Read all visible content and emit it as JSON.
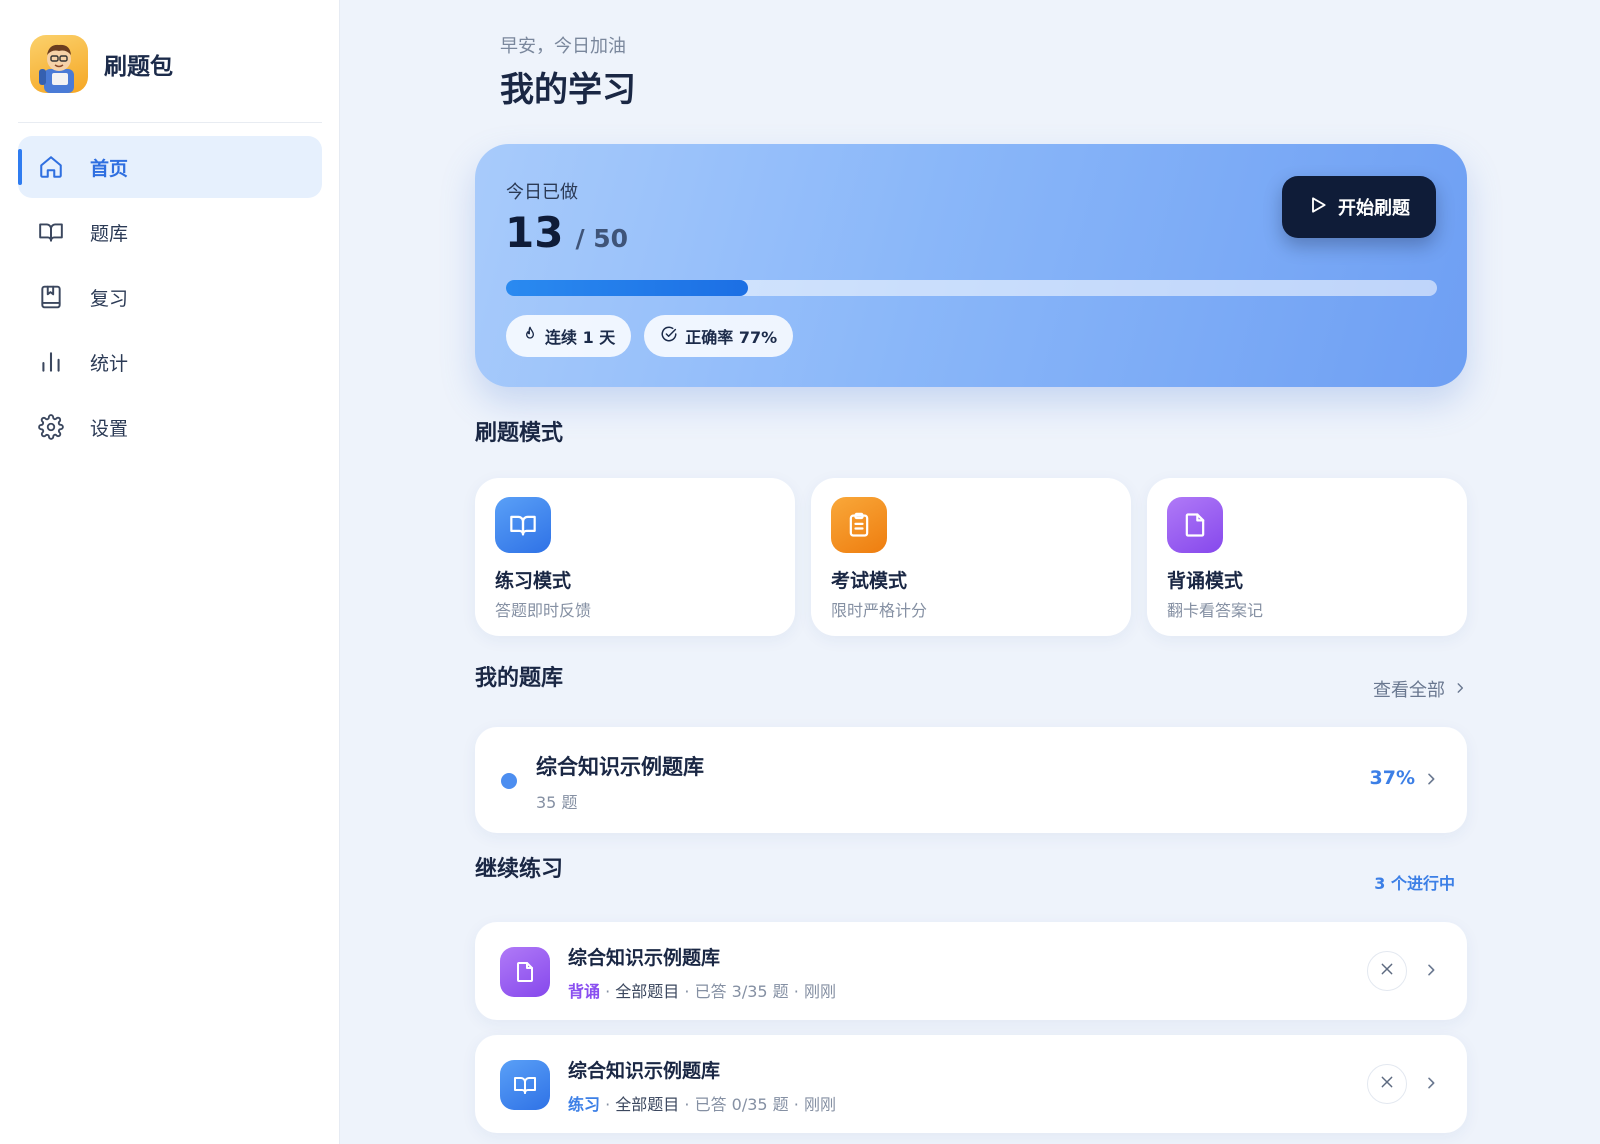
{
  "app": {
    "name": "刷题包"
  },
  "sidebar": {
    "items": [
      {
        "label": "首页",
        "icon": "home-icon",
        "active": true
      },
      {
        "label": "题库",
        "icon": "book-open-icon"
      },
      {
        "label": "复习",
        "icon": "bookmark-book-icon"
      },
      {
        "label": "统计",
        "icon": "bar-chart-icon"
      },
      {
        "label": "设置",
        "icon": "gear-icon"
      }
    ]
  },
  "header": {
    "greeting": "早安，今日加油",
    "title": "我的学习"
  },
  "today": {
    "label": "今日已做",
    "done": "13",
    "total": "/ 50",
    "progress": 0.26,
    "streak": "连续 1 天",
    "accuracy": "正确率 77%",
    "start_label": "开始刷题"
  },
  "modes": {
    "title": "刷题模式",
    "items": [
      {
        "name": "练习模式",
        "desc": "答题即时反馈",
        "icon": "book-open-icon",
        "color": "#3f86f1"
      },
      {
        "name": "考试模式",
        "desc": "限时严格计分",
        "icon": "clipboard-icon",
        "color": "#f28c1b"
      },
      {
        "name": "背诵模式",
        "desc": "翻卡看答案记",
        "icon": "file-icon",
        "color": "#9b5cf0"
      }
    ]
  },
  "my_banks": {
    "title": "我的题库",
    "view_all": "查看全部",
    "items": [
      {
        "name": "综合知识示例题库",
        "count": "35 题",
        "percent": "37%"
      }
    ]
  },
  "continue": {
    "title": "继续练习",
    "badge": "3 个进行中",
    "items": [
      {
        "name": "综合知识示例题库",
        "mode": "背诵",
        "mode_color": "#8a4ff0",
        "scope": "全部题目",
        "answered": "已答 3/35 题",
        "time": "刚刚",
        "icon": "file-icon"
      },
      {
        "name": "综合知识示例题库",
        "mode": "练习",
        "mode_color": "#3c7fe6",
        "scope": "全部题目",
        "answered": "已答 0/35 题",
        "time": "刚刚",
        "icon": "book-open-icon"
      }
    ],
    "separator": " · "
  },
  "colors": {
    "accent": "#2f7cf0",
    "dark": "#0f1c38",
    "background": "#eef3fb"
  }
}
